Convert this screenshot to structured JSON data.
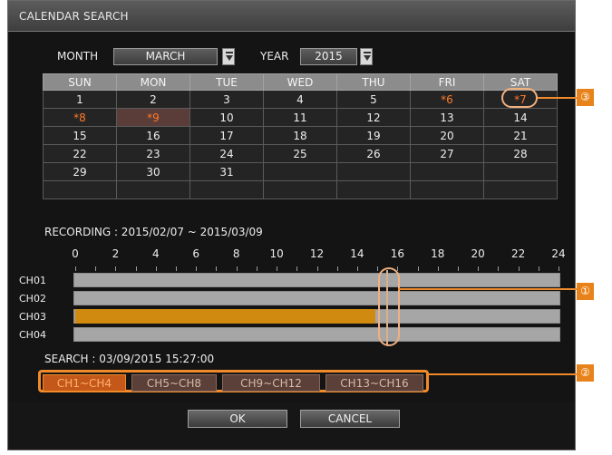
{
  "window": {
    "title": "CALENDAR SEARCH"
  },
  "filters": {
    "month_label": "MONTH",
    "month_value": "MARCH",
    "year_label": "YEAR",
    "year_value": "2015"
  },
  "calendar": {
    "weekdays": [
      "SUN",
      "MON",
      "TUE",
      "WED",
      "THU",
      "FRI",
      "SAT"
    ],
    "rows": [
      [
        "1",
        "2",
        "3",
        "4",
        "5",
        "*6",
        "*7"
      ],
      [
        "*8",
        "*9",
        "10",
        "11",
        "12",
        "13",
        "14"
      ],
      [
        "15",
        "16",
        "17",
        "18",
        "19",
        "20",
        "21"
      ],
      [
        "22",
        "23",
        "24",
        "25",
        "26",
        "27",
        "28"
      ],
      [
        "29",
        "30",
        "31",
        "",
        "",
        "",
        ""
      ],
      [
        "",
        "",
        "",
        "",
        "",
        "",
        ""
      ]
    ]
  },
  "recording": {
    "range_text": "RECORDING : 2015/02/07 ~ 2015/03/09"
  },
  "timeline": {
    "hour_labels": [
      "0",
      "2",
      "4",
      "6",
      "8",
      "10",
      "12",
      "14",
      "16",
      "18",
      "20",
      "22",
      "24"
    ],
    "channels": [
      {
        "label": "CH01",
        "recorded_until_hour": 0
      },
      {
        "label": "CH02",
        "recorded_until_hour": 0
      },
      {
        "label": "CH03",
        "recorded_until_hour": 14.9
      },
      {
        "label": "CH04",
        "recorded_until_hour": 0
      }
    ],
    "cursor_hour": 15.45
  },
  "search": {
    "time_text": "SEARCH : 03/09/2015 15:27:00"
  },
  "channel_groups": [
    "CH1~CH4",
    "CH5~CH8",
    "CH9~CH12",
    "CH13~CH16"
  ],
  "buttons": {
    "ok": "OK",
    "cancel": "CANCEL"
  },
  "callouts": {
    "one": "①",
    "two": "②",
    "three": "③"
  },
  "colors": {
    "accent": "#f08a2a",
    "recording": "#d08a10",
    "record_day": "#ff7a2a"
  }
}
